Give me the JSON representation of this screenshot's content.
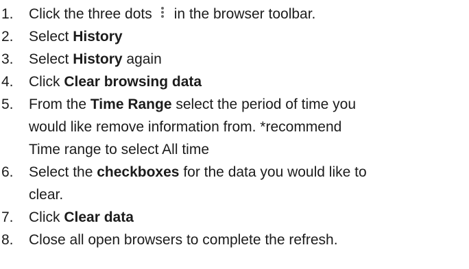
{
  "steps": [
    {
      "num": "1.",
      "pre": "Click the three dots",
      "icon": "three-dots-vertical-icon",
      "post": "in the browser toolbar."
    },
    {
      "num": "2.",
      "pre": "Select ",
      "bold": "History"
    },
    {
      "num": "3.",
      "pre": "Select ",
      "bold": "History",
      "post": " again"
    },
    {
      "num": "4.",
      "pre": "Click ",
      "bold": "Clear browsing data"
    },
    {
      "num": "5.",
      "pre": "From the ",
      "bold": "Time Range",
      "post": " select the period of time you",
      "line2": "would like remove information from. *recommend",
      "line3": "Time range to select All time"
    },
    {
      "num": "6.",
      "pre": "Select the ",
      "bold": "checkboxes",
      "post": " for the data you would like to",
      "line2": "clear."
    },
    {
      "num": "7.",
      "pre": "Click ",
      "bold": "Clear data"
    },
    {
      "num": "8.",
      "pre": "Close all open browsers to complete the refresh."
    }
  ]
}
